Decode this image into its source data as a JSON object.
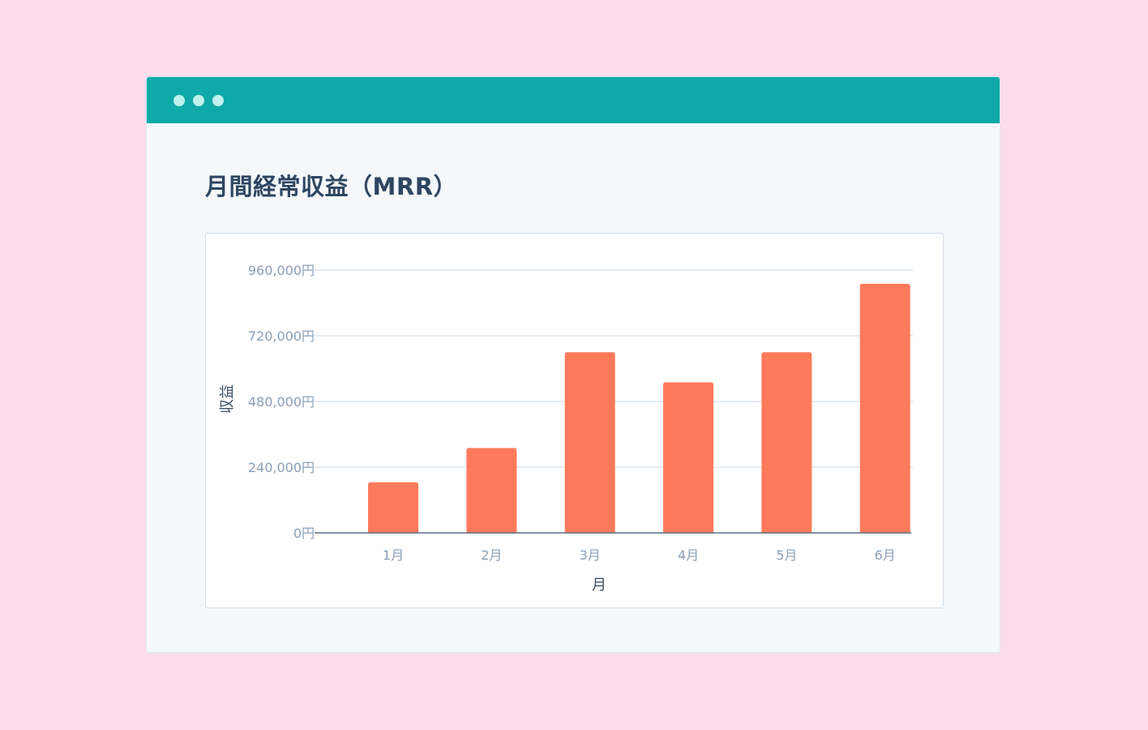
{
  "window": {
    "title": "月間経常収益（MRR）"
  },
  "colors": {
    "background": "#fbdcea",
    "titlebar": "#0ea9a8",
    "bar": "#ff7a5a",
    "grid": "#dce5ee",
    "axis": "#5a6e84"
  },
  "chart_data": {
    "type": "bar",
    "title": "月間経常収益（MRR）",
    "xlabel": "月",
    "ylabel": "収益",
    "categories": [
      "1月",
      "2月",
      "3月",
      "4月",
      "5月",
      "6月"
    ],
    "values": [
      185000,
      310000,
      660000,
      550000,
      660000,
      910000
    ],
    "ylim": [
      0,
      960000
    ],
    "yticks": [
      0,
      240000,
      480000,
      720000,
      960000
    ],
    "ytick_labels": [
      "0円",
      "240,000円",
      "480,000円",
      "720,000円",
      "960,000円"
    ],
    "grid": true,
    "legend": "none"
  }
}
